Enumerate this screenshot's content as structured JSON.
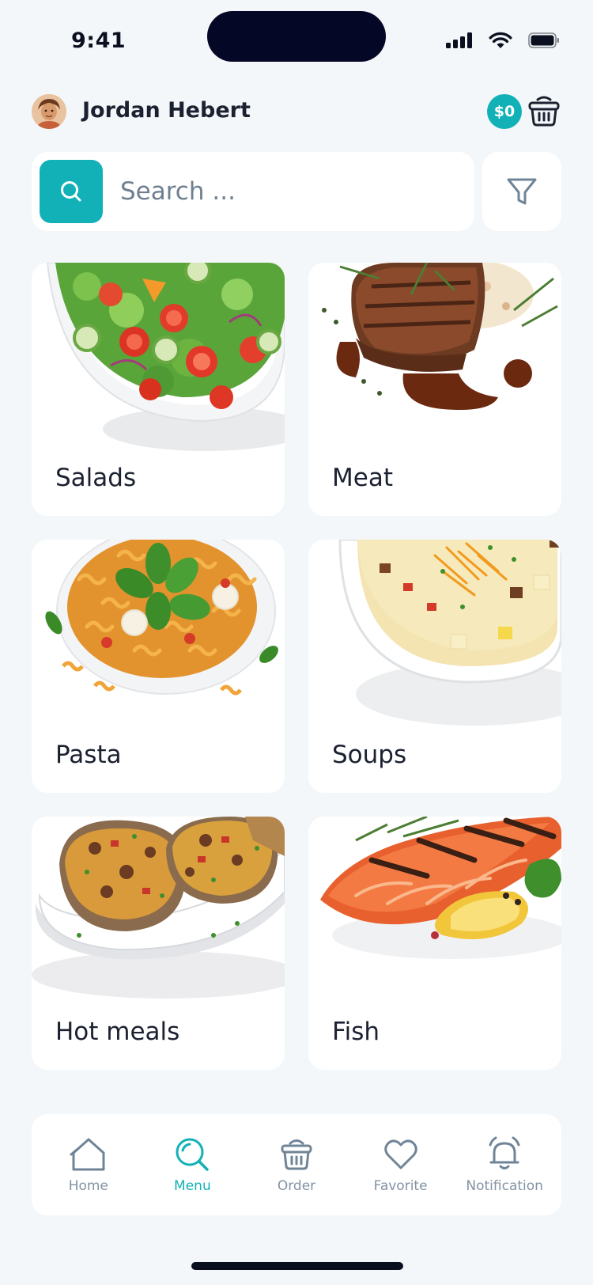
{
  "status_bar": {
    "time": "9:41"
  },
  "header": {
    "user_name": "Jordan Hebert",
    "balance": "$0"
  },
  "search": {
    "placeholder": "Search ..."
  },
  "categories": [
    {
      "label": "Salads"
    },
    {
      "label": "Meat"
    },
    {
      "label": "Pasta"
    },
    {
      "label": "Soups"
    },
    {
      "label": "Hot meals"
    },
    {
      "label": "Fish"
    }
  ],
  "nav": {
    "items": [
      {
        "label": "Home",
        "icon": "home-icon",
        "active": false
      },
      {
        "label": "Menu",
        "icon": "search-icon",
        "active": true
      },
      {
        "label": "Order",
        "icon": "basket-icon",
        "active": false
      },
      {
        "label": "Favorite",
        "icon": "heart-icon",
        "active": false
      },
      {
        "label": "Notification",
        "icon": "bell-icon",
        "active": false
      }
    ]
  },
  "colors": {
    "accent": "#12b1b8",
    "background": "#f3f7f9",
    "card": "#ffffff",
    "muted": "#8393a3"
  }
}
